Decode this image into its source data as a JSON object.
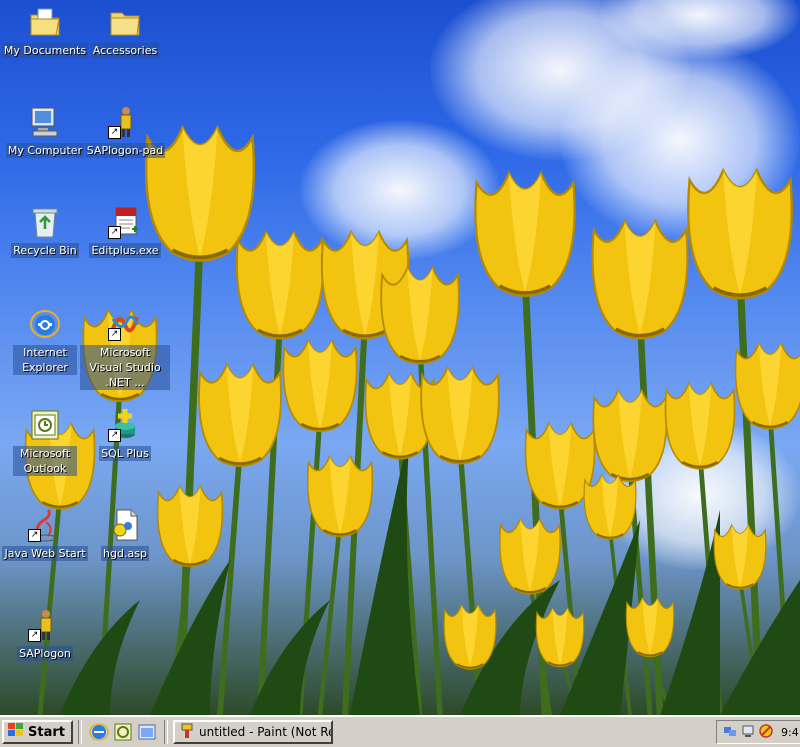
{
  "desktop": {
    "icons": [
      {
        "label": "My Documents",
        "icon": "my-documents-icon"
      },
      {
        "label": "Accessories",
        "icon": "folder-icon"
      },
      {
        "label": "My Computer",
        "icon": "my-computer-icon"
      },
      {
        "label": "SAPlogon-pad",
        "icon": "saplogon-pad-icon"
      },
      {
        "label": "Recycle Bin",
        "icon": "recycle-bin-icon"
      },
      {
        "label": "Editplus.exe",
        "icon": "editplus-icon"
      },
      {
        "label": "Internet Explorer",
        "icon": "internet-explorer-icon"
      },
      {
        "label": "Microsoft Visual Studio .NET ...",
        "icon": "visual-studio-icon"
      },
      {
        "label": "Microsoft Outlook",
        "icon": "outlook-icon"
      },
      {
        "label": "SQL Plus",
        "icon": "sql-plus-icon"
      },
      {
        "label": "Java Web Start",
        "icon": "java-web-start-icon"
      },
      {
        "label": "hgd.asp",
        "icon": "asp-file-icon"
      },
      {
        "label": "SAPlogon",
        "icon": "saplogon-icon"
      }
    ]
  },
  "taskbar": {
    "start_label": "Start",
    "quick_launch": [
      "internet-explorer-icon",
      "outlook-icon",
      "show-desktop-icon"
    ],
    "tasks": [
      {
        "label": "untitled - Paint (Not Res...",
        "icon": "paint-icon"
      }
    ],
    "clock": "9:4"
  },
  "colors": {
    "taskbar": "#d4d0c8",
    "sky": "#2f6ae8",
    "tulip": "#f2c410"
  }
}
